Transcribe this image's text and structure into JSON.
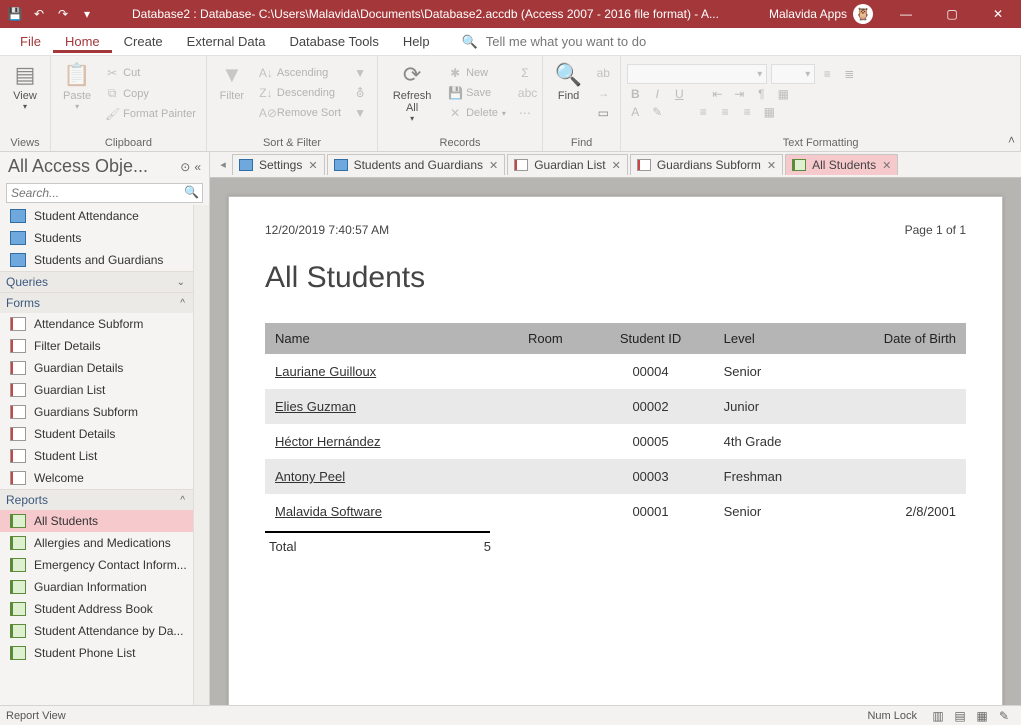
{
  "titlebar": {
    "title": "Database2 : Database- C:\\Users\\Malavida\\Documents\\Database2.accdb (Access 2007 - 2016 file format) -  A...",
    "app_badge": "Malavida Apps"
  },
  "ribbon_tabs": [
    "File",
    "Home",
    "Create",
    "External Data",
    "Database Tools",
    "Help"
  ],
  "tell_me": "Tell me what you want to do",
  "ribbon": {
    "views": {
      "view": "View",
      "label": "Views"
    },
    "clipboard": {
      "paste": "Paste",
      "cut": "Cut",
      "copy": "Copy",
      "fmt": "Format Painter",
      "label": "Clipboard"
    },
    "sortfilter": {
      "filter": "Filter",
      "asc": "Ascending",
      "desc": "Descending",
      "remove": "Remove Sort",
      "label": "Sort & Filter"
    },
    "records": {
      "refresh": "Refresh All",
      "new": "New",
      "save": "Save",
      "delete": "Delete",
      "label": "Records"
    },
    "find": {
      "find": "Find",
      "label": "Find"
    },
    "textfmt": {
      "label": "Text Formatting"
    }
  },
  "nav": {
    "title": "All Access Obje...",
    "search_placeholder": "Search...",
    "tables": [
      "Student Attendance",
      "Students",
      "Students and Guardians"
    ],
    "queries_label": "Queries",
    "forms_label": "Forms",
    "forms": [
      "Attendance Subform",
      "Filter Details",
      "Guardian Details",
      "Guardian List",
      "Guardians Subform",
      "Student Details",
      "Student List",
      "Welcome"
    ],
    "reports_label": "Reports",
    "reports": [
      "All Students",
      "Allergies and Medications",
      "Emergency Contact Inform...",
      "Guardian Information",
      "Student Address Book",
      "Student Attendance by Da...",
      "Student Phone List"
    ]
  },
  "doctabs": [
    {
      "label": "Settings",
      "type": "table"
    },
    {
      "label": "Students and Guardians",
      "type": "table"
    },
    {
      "label": "Guardian List",
      "type": "form"
    },
    {
      "label": "Guardians Subform",
      "type": "form"
    },
    {
      "label": "All Students",
      "type": "report"
    }
  ],
  "report": {
    "timestamp": "12/20/2019 7:40:57 AM",
    "page": "Page 1 of 1",
    "title": "All Students",
    "headers": {
      "name": "Name",
      "room": "Room",
      "id": "Student ID",
      "level": "Level",
      "dob": "Date of Birth"
    },
    "rows": [
      {
        "name": "Lauriane Guilloux",
        "room": "",
        "id": "00004",
        "level": "Senior",
        "dob": ""
      },
      {
        "name": "Elies Guzman",
        "room": "",
        "id": "00002",
        "level": "Junior",
        "dob": ""
      },
      {
        "name": "Héctor Hernández",
        "room": "",
        "id": "00005",
        "level": "4th Grade",
        "dob": ""
      },
      {
        "name": "Antony Peel",
        "room": "",
        "id": "00003",
        "level": "Freshman",
        "dob": ""
      },
      {
        "name": "Malavida Software",
        "room": "",
        "id": "00001",
        "level": "Senior",
        "dob": "2/8/2001"
      }
    ],
    "total_label": "Total",
    "total_value": "5"
  },
  "statusbar": {
    "left": "Report View",
    "numlock": "Num Lock"
  }
}
